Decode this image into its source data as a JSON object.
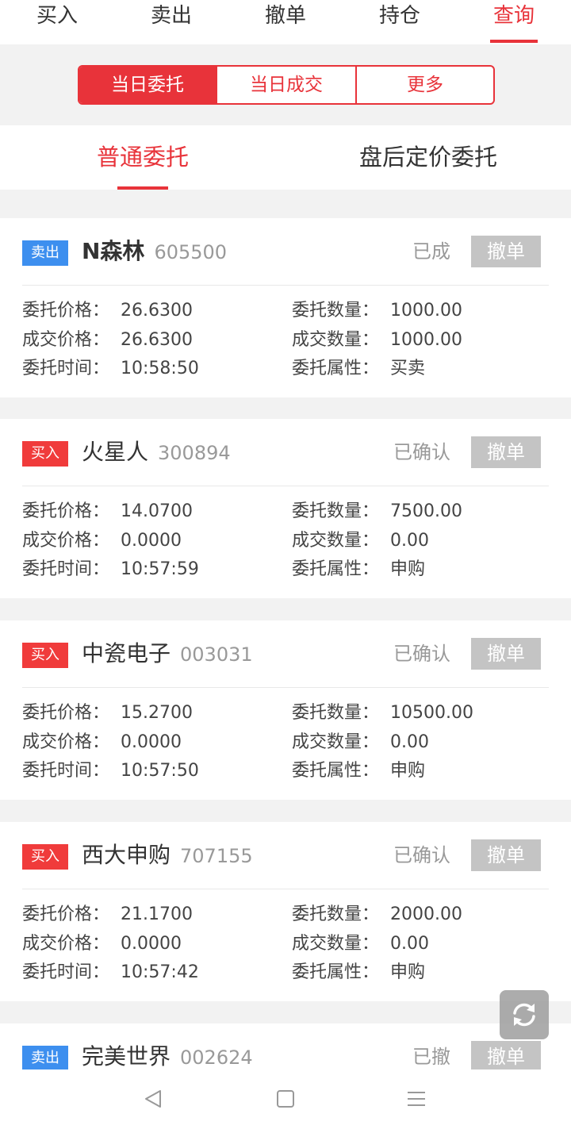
{
  "top_tabs": [
    "买入",
    "卖出",
    "撤单",
    "持仓",
    "查询"
  ],
  "segments": [
    "当日委托",
    "当日成交",
    "更多"
  ],
  "sub_tabs": [
    "普通委托",
    "盘后定价委托"
  ],
  "colors": {
    "accent": "#e8333a",
    "buy_badge": "#f03b3b",
    "sell_badge": "#3d8fef",
    "cancel_btn": "#c4c4c4"
  },
  "labels": {
    "order_price": "委托价格：",
    "order_qty": "委托数量：",
    "deal_price": "成交价格：",
    "deal_qty": "成交数量：",
    "order_time": "委托时间：",
    "order_attr": "委托属性："
  },
  "orders": [
    {
      "side": "卖出",
      "name": "N森林",
      "code": "605500",
      "status": "已成",
      "cancel": "撤单",
      "order_price": "26.6300",
      "order_qty": "1000.00",
      "deal_price": "26.6300",
      "deal_qty": "1000.00",
      "order_time": "10:58:50",
      "order_attr": "买卖"
    },
    {
      "side": "买入",
      "name": "火星人",
      "code": "300894",
      "status": "已确认",
      "cancel": "撤单",
      "order_price": "14.0700",
      "order_qty": "7500.00",
      "deal_price": "0.0000",
      "deal_qty": "0.00",
      "order_time": "10:57:59",
      "order_attr": "申购"
    },
    {
      "side": "买入",
      "name": "中瓷电子",
      "code": "003031",
      "status": "已确认",
      "cancel": "撤单",
      "order_price": "15.2700",
      "order_qty": "10500.00",
      "deal_price": "0.0000",
      "deal_qty": "0.00",
      "order_time": "10:57:50",
      "order_attr": "申购"
    },
    {
      "side": "买入",
      "name": "西大申购",
      "code": "707155",
      "status": "已确认",
      "cancel": "撤单",
      "order_price": "21.1700",
      "order_qty": "2000.00",
      "deal_price": "0.0000",
      "deal_qty": "0.00",
      "order_time": "10:57:42",
      "order_attr": "申购"
    },
    {
      "side": "卖出",
      "name": "完美世界",
      "code": "002624",
      "status": "已撤",
      "cancel": "撤单"
    }
  ],
  "icons": {
    "refresh": "refresh-icon",
    "back": "back-triangle-icon",
    "home": "home-square-icon",
    "menu": "menu-lines-icon"
  }
}
